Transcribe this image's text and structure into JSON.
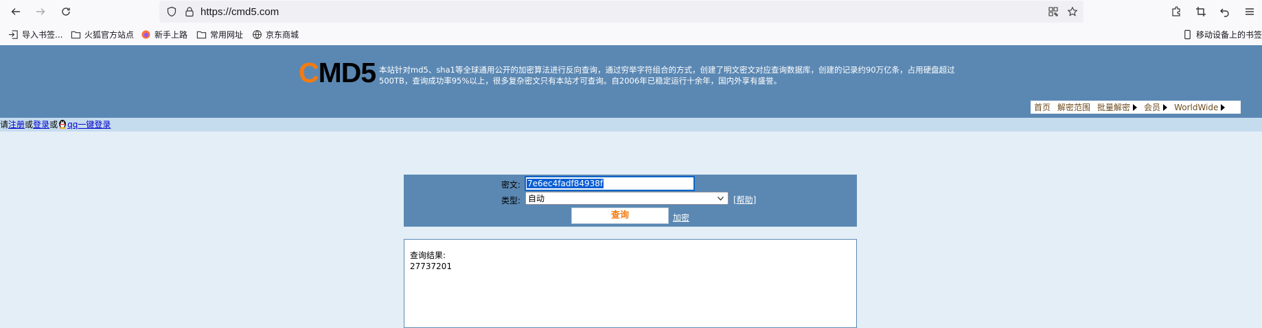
{
  "browser": {
    "url": "https://cmd5.com",
    "bookmarks": [
      {
        "label": "导入书签...",
        "icon": "import-icon"
      },
      {
        "label": "火狐官方站点",
        "icon": "folder-icon"
      },
      {
        "label": "新手上路",
        "icon": "firefox-icon"
      },
      {
        "label": "常用网址",
        "icon": "folder-icon"
      },
      {
        "label": "京东商城",
        "icon": "globe-icon"
      }
    ],
    "mobile_bookmarks": "移动设备上的书签"
  },
  "site": {
    "logo_first": "C",
    "logo_rest": "MD5",
    "intro": "本站针对md5、sha1等全球通用公开的加密算法进行反向查询，通过穷举字符组合的方式，创建了明文密文对应查询数据库，创建的记录约90万亿条，占用硬盘超过500TB，查询成功率95%以上，很多复杂密文只有本站才可查询。自2006年已稳定运行十余年，国内外享有盛誉。",
    "nav": [
      "首页",
      "解密范围",
      "批量解密",
      "会员",
      "WorldWide"
    ],
    "login": {
      "prefix": "请",
      "register": "注册",
      "or1": "或",
      "login": "登录",
      "or2": "或",
      "qq": "qq一键登录"
    }
  },
  "form": {
    "cipher_label": "密文:",
    "cipher_value": "7e6ec4fadf84938f",
    "type_label": "类型:",
    "type_value": "自动",
    "help": "[帮助]",
    "query_button": "查询",
    "encrypt_link": "加密"
  },
  "result": {
    "label": "查询结果:",
    "value": "27737201"
  },
  "colors": {
    "header_bg": "#5b88b3",
    "logo_accent": "#f47b0f",
    "page_bg": "#e3eef7"
  }
}
